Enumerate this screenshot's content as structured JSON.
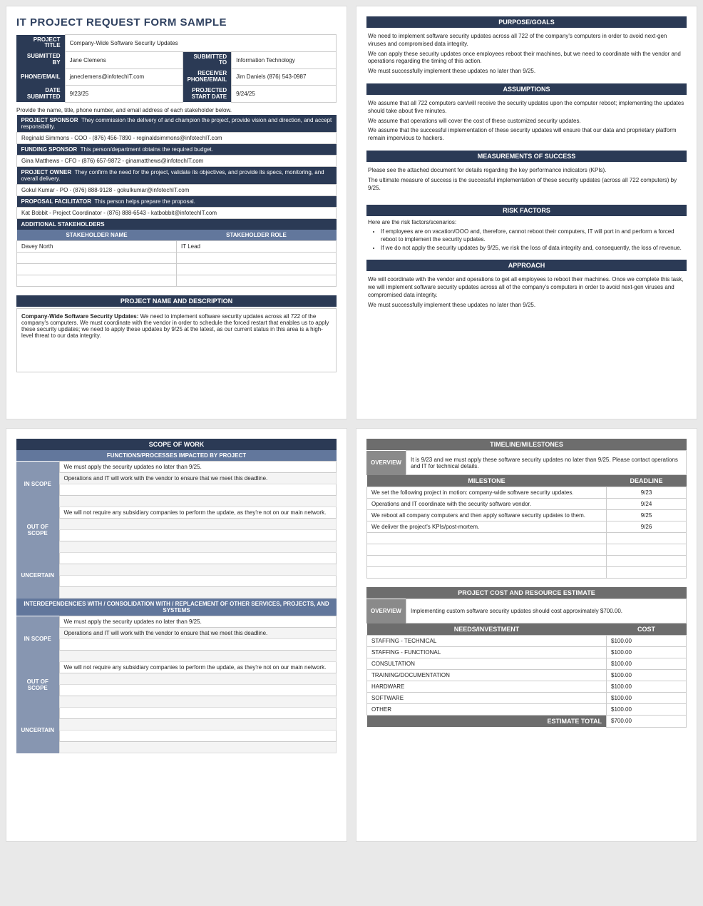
{
  "title": "IT PROJECT REQUEST FORM SAMPLE",
  "header": {
    "labels": {
      "project_title": "PROJECT TITLE",
      "submitted_by": "SUBMITTED BY",
      "phone_email": "PHONE/EMAIL",
      "date_submitted": "DATE SUBMITTED",
      "submitted_to": "SUBMITTED TO",
      "receiver": "RECEIVER PHONE/EMAIL",
      "projected": "PROJECTED START DATE"
    },
    "values": {
      "project_title": "Company-Wide Software Security Updates",
      "submitted_by": "Jane Clemens",
      "phone_email": "janeclemens@infotechIT.com",
      "date_submitted": "9/23/25",
      "submitted_to": "Information Technology",
      "receiver": "Jim Daniels (876) 543-0987",
      "projected": "9/24/25"
    }
  },
  "stakeholders": {
    "intro": "Provide the name, title, phone number, and email address of each stakeholder below.",
    "rows": [
      {
        "h": "PROJECT SPONSOR",
        "d": "They commission the delivery of and champion the project, provide vision and direction, and accept responsibility.",
        "v": "Reginald Simmons - COO - (876) 456-7890 - reginaldsimmons@infotechIT.com"
      },
      {
        "h": "FUNDING SPONSOR",
        "d": "This person/department obtains the required budget.",
        "v": "Gina Matthews - CFO - (876) 657-9872 - ginamatthews@infotechIT.com"
      },
      {
        "h": "PROJECT OWNER",
        "d": "They confirm the need for the project, validate its objectives, and provide its specs, monitoring, and overall delivery.",
        "v": "Gokul Kumar - PO - (876) 888-9128 - gokulkumar@infotechIT.com"
      },
      {
        "h": "PROPOSAL FACILITATOR",
        "d": "This person helps prepare the proposal.",
        "v": "Kat Bobbit - Project Coordinator - (876) 888-6543 - katbobbit@infotechIT.com"
      }
    ],
    "additional_title": "ADDITIONAL STAKEHOLDERS",
    "cols": {
      "name": "STAKEHOLDER NAME",
      "role": "STAKEHOLDER ROLE"
    },
    "additional": [
      {
        "name": "Davey North",
        "role": "IT Lead"
      }
    ]
  },
  "desc": {
    "title": "PROJECT NAME AND DESCRIPTION",
    "bold": "Company-Wide Software Security Updates:",
    "text": " We need to implement software security updates across all 722 of the company's computers. We must coordinate with the vendor in order to schedule the forced restart that enables us to apply these security updates; we need to apply these updates by 9/25 at the latest, as our current status in this area is a high-level threat to our data integrity."
  },
  "purpose": {
    "title": "PURPOSE/GOALS",
    "p1": "We need to implement software security updates across all 722 of the company's computers in order to avoid next-gen viruses and compromised data integrity.",
    "p2": "We can apply these security updates once employees reboot their machines, but we need to coordinate with the vendor and operations regarding the timing of this action.",
    "p3": "We must successfully implement these updates no later than 9/25."
  },
  "assumptions": {
    "title": "ASSUMPTIONS",
    "p1": "We assume that all 722 computers can/will receive the security updates upon the computer reboot; implementing the updates should take about five minutes.",
    "p2": "We assume that operations will cover the cost of these customized security updates.",
    "p3": "We assume that the successful implementation of these security updates will ensure that our data and proprietary platform remain impervious to hackers."
  },
  "measure": {
    "title": "MEASUREMENTS OF SUCCESS",
    "p1": "Please see the attached document for details regarding the key performance indicators (KPIs).",
    "p2": "The ultimate measure of success is the successful implementation of these security updates (across all 722 computers) by 9/25."
  },
  "risk": {
    "title": "RISK FACTORS",
    "intro": "Here are the risk factors/scenarios:",
    "b1": "If employees are on vacation/OOO and, therefore, cannot reboot their computers, IT will port in and perform a forced reboot to implement the security updates.",
    "b2": "If we do not apply the security updates by 9/25, we risk the loss of data integrity and, consequently, the loss of revenue."
  },
  "approach": {
    "title": "APPROACH",
    "p1": "We will coordinate with the vendor and operations to get all employees to reboot their machines. Once we complete this task, we will implement software security updates across all of the company's computers in order to avoid next-gen viruses and compromised data integrity.",
    "p2": "We must successfully implement these updates no later than 9/25."
  },
  "scope": {
    "title": "SCOPE OF WORK",
    "sub": "FUNCTIONS/PROCESSES IMPACTED BY PROJECT",
    "labels": {
      "in": "IN SCOPE",
      "out": "OUT OF SCOPE",
      "unc": "UNCERTAIN"
    },
    "in1": "We must apply the security updates no later than 9/25.",
    "in2": "Operations and IT will work with the vendor to ensure that we meet this deadline.",
    "out1": "We will not require any subsidiary companies to perform the update, as they're not on our main network.",
    "inter_title": "INTERDEPENDENCIES WITH / CONSOLIDATION WITH / REPLACEMENT OF OTHER SERVICES, PROJECTS, AND SYSTEMS"
  },
  "timeline": {
    "title": "TIMELINE/MILESTONES",
    "overview_l": "OVERVIEW",
    "overview": "It is 9/23 and we must apply these software security updates no later than 9/25. Please contact operations and IT for technical details.",
    "cols": {
      "m": "MILESTONE",
      "d": "DEADLINE"
    },
    "rows": [
      {
        "m": "We set the following project in motion: company-wide software security updates.",
        "d": "9/23"
      },
      {
        "m": "Operations and IT coordinate with the security software vendor.",
        "d": "9/24"
      },
      {
        "m": "We reboot all company computers and then apply software security updates to them.",
        "d": "9/25"
      },
      {
        "m": "We deliver the project's KPIs/post-mortem.",
        "d": "9/26"
      }
    ]
  },
  "cost": {
    "title": "PROJECT COST AND RESOURCE ESTIMATE",
    "overview_l": "OVERVIEW",
    "overview": "Implementing custom software security updates should cost approximately $700.00.",
    "cols": {
      "n": "NEEDS/INVESTMENT",
      "c": "COST"
    },
    "rows": [
      {
        "n": "STAFFING - TECHNICAL",
        "c": "$100.00"
      },
      {
        "n": "STAFFING - FUNCTIONAL",
        "c": "$100.00"
      },
      {
        "n": "CONSULTATION",
        "c": "$100.00"
      },
      {
        "n": "TRAINING/DOCUMENTATION",
        "c": "$100.00"
      },
      {
        "n": "HARDWARE",
        "c": "$100.00"
      },
      {
        "n": "SOFTWARE",
        "c": "$100.00"
      },
      {
        "n": "OTHER",
        "c": "$100.00"
      }
    ],
    "total_l": "ESTIMATE TOTAL",
    "total": "$700.00"
  },
  "chart_data": {
    "type": "table",
    "title": "Project Cost and Resource Estimate",
    "categories": [
      "STAFFING - TECHNICAL",
      "STAFFING - FUNCTIONAL",
      "CONSULTATION",
      "TRAINING/DOCUMENTATION",
      "HARDWARE",
      "SOFTWARE",
      "OTHER"
    ],
    "values": [
      100,
      100,
      100,
      100,
      100,
      100,
      100
    ],
    "total": 700,
    "currency": "USD"
  }
}
